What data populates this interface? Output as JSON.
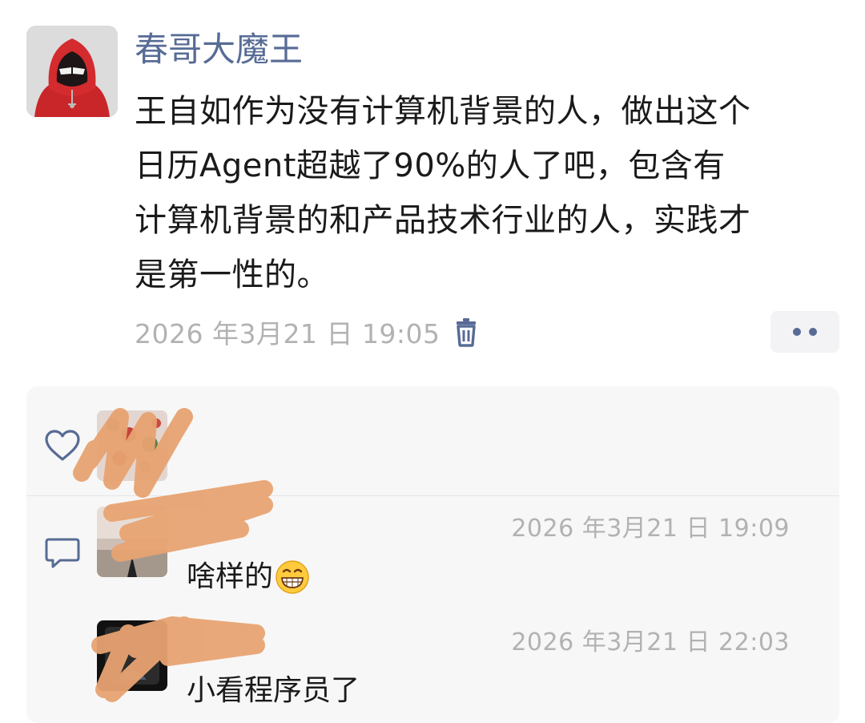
{
  "post": {
    "author": "春哥大魔王",
    "text_lines": [
      "王自如作为没有计算机背景的人，做出这个",
      "日历Agent超越了90%的人了吧，包含有",
      "计算机背景的和产品技术行业的人，实践才",
      "是第一性的。"
    ],
    "timestamp": "2026 年3月21 日 19:05"
  },
  "comments": [
    {
      "time": "2026 年3月21 日 19:09",
      "text": "啥样的",
      "emoji": "grinning-face-emoji"
    },
    {
      "time": "2026 年3月21 日 22:03",
      "text": "小看程序员了"
    }
  ],
  "colors": {
    "name_blue": "#576b95",
    "timestamp_gray": "#b2b2b2",
    "panel_bg": "#f7f7f7",
    "scribble_orange": "#e8a372"
  },
  "icons": {
    "delete": "trash-icon",
    "more": "more-dots-icon",
    "like": "heart-icon",
    "comment": "comment-bubble-icon"
  }
}
